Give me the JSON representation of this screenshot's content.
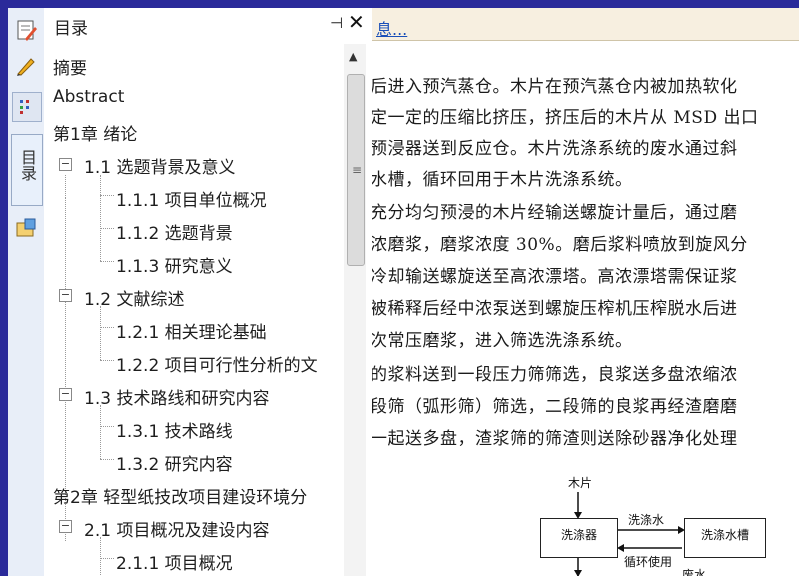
{
  "panel": {
    "title": "目录",
    "pin_glyph": "⊣",
    "close_glyph": "✕"
  },
  "vertical_tab_label": "目录",
  "toolstrip_icons": [
    "notes-icon",
    "pen-icon",
    "outline-icon",
    "attachment-icon"
  ],
  "toc": [
    {
      "label": "摘要"
    },
    {
      "label": "Abstract"
    },
    {
      "label": "第1章 绪论"
    },
    {
      "label": "1.1 选题背景及意义"
    },
    {
      "label": "1.1.1 项目单位概况"
    },
    {
      "label": "1.1.2 选题背景"
    },
    {
      "label": "1.1.3 研究意义"
    },
    {
      "label": "1.2 文献综述"
    },
    {
      "label": "1.2.1 相关理论基础"
    },
    {
      "label": "1.2.2 项目可行性分析的文"
    },
    {
      "label": "1.3 技术路线和研究内容"
    },
    {
      "label": "1.3.1 技术路线"
    },
    {
      "label": "1.3.2 研究内容"
    },
    {
      "label": "第2章 轻型纸技改项目建设环境分"
    },
    {
      "label": "2.1 项目概况及建设内容"
    },
    {
      "label": "2.1.1 项目概况"
    }
  ],
  "document": {
    "info_link": "息...",
    "lines": [
      "后进入预汽蒸仓。木片在预汽蒸仓内被加热软化",
      "定一定的压缩比挤压，挤压后的木片从 MSD 出口",
      "预浸器送到反应仓。木片洗涤系统的废水通过斜",
      "水槽，循环回用于木片洗涤系统。",
      "充分均匀预浸的木片经输送螺旋计量后，通过磨",
      "浓磨浆，磨浆浓度 30%。磨后浆料喷放到旋风分",
      "冷却输送螺旋送至高浓漂塔。高浓漂塔需保证浆",
      "被稀释后经中浓泵送到螺旋压榨机压榨脱水后进",
      "次常压磨浆，进入筛选洗涤系统。",
      "的浆料送到一段压力筛筛选，良浆送多盘浓缩浓",
      "段筛（弧形筛）筛选，二段筛的良浆再经渣磨磨",
      "一起送多盘，渣浆筛的筛渣则送除砂器净化处理"
    ],
    "flowchart": {
      "input": "木片",
      "box_left": "洗涤器",
      "box_right": "洗涤水槽",
      "arrow_top": "洗涤水",
      "arrow_bottom": "循环使用",
      "bottom_label": "废水"
    }
  }
}
